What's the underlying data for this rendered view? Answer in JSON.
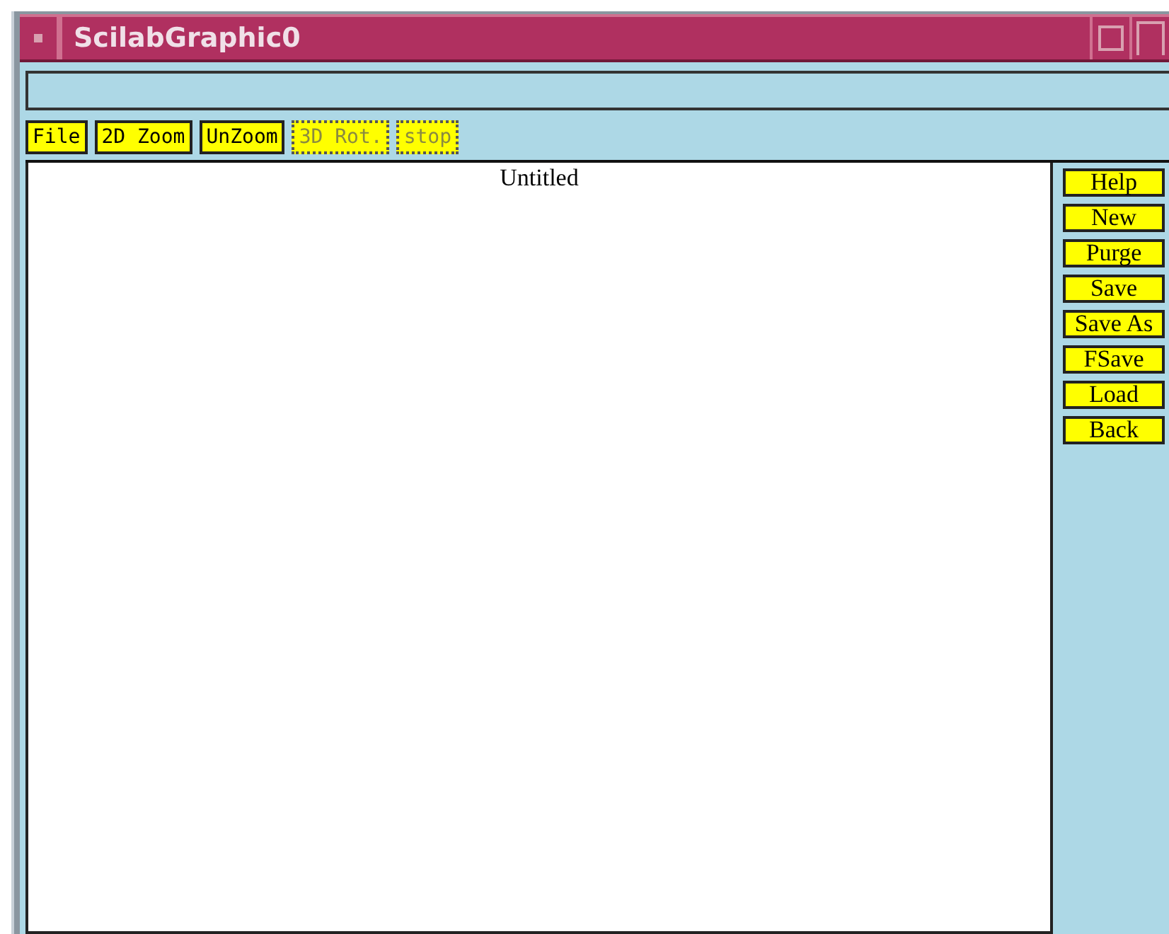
{
  "window": {
    "title": "ScilabGraphic0"
  },
  "toolbar": [
    {
      "label": "File",
      "disabled": false
    },
    {
      "label": "2D Zoom",
      "disabled": false
    },
    {
      "label": "UnZoom",
      "disabled": false
    },
    {
      "label": "3D Rot.",
      "disabled": true
    },
    {
      "label": "stop",
      "disabled": true
    }
  ],
  "canvas": {
    "title": "Untitled"
  },
  "side_buttons": [
    "Help",
    "New",
    "Purge",
    "Save",
    "Save As",
    "FSave",
    "Load",
    "Back"
  ]
}
